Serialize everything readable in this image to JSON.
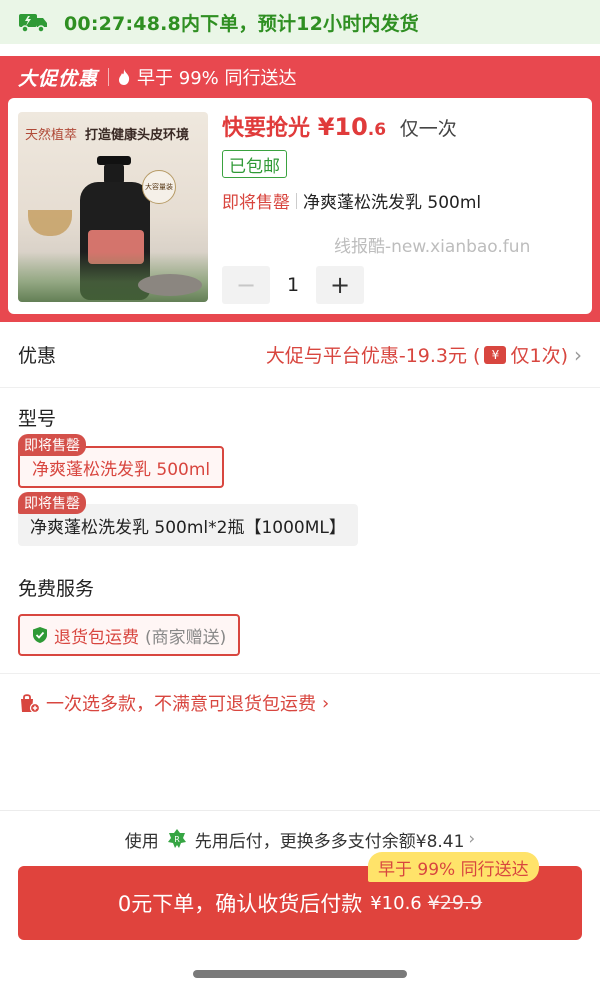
{
  "shipping_banner": {
    "text": "00:27:48.8内下单，预计12小时内发货",
    "icon": "truck-icon",
    "color": "#2f8f22"
  },
  "promo": {
    "title": "大促优惠",
    "fast_text": "早于 99% 同行送达",
    "bg_color": "#e8484f",
    "product": {
      "image_text_1": "天然植萃",
      "image_text_2": "打造健康头皮环境",
      "image_badge": "大容量装",
      "grab_prefix": "快要抢光",
      "currency": "¥",
      "price_int": "10",
      "price_dec": ".6",
      "once": "仅一次",
      "free_shipping": "已包邮",
      "soon_label": "即将售罄",
      "name": "净爽蓬松洗发乳 500ml",
      "watermark": "线报酷-new.xianbao.fun",
      "quantity": "1",
      "minus": "−",
      "plus": "+"
    }
  },
  "discount": {
    "label": "优惠",
    "value_prefix": "大促与平台优惠-19.3元 (",
    "coupon_icon": "¥",
    "value_suffix": "仅1次)",
    "chevron": "›"
  },
  "model": {
    "title": "型号",
    "options": [
      {
        "tag": "即将售罄",
        "label": "净爽蓬松洗发乳 500ml",
        "selected": true
      },
      {
        "tag": "即将售罄",
        "label": "净爽蓬松洗发乳 500ml*2瓶【1000ML】",
        "selected": false
      }
    ]
  },
  "services": {
    "title": "免费服务",
    "item_name": "退货包运费",
    "item_note": "(商家赠送)"
  },
  "multi_select": {
    "text": "一次选多款，不满意可退货包运费",
    "chevron": "›"
  },
  "pay_later": {
    "prefix": "使用",
    "text": "先用后付，更换多多支付余额¥8.41",
    "chevron": "›"
  },
  "order_button": {
    "label": "0元下单，确认收货后付款",
    "price": "¥10.6",
    "old_price": "¥29.9",
    "color": "#e0433d"
  },
  "early_tag": "早于 99% 同行送达"
}
